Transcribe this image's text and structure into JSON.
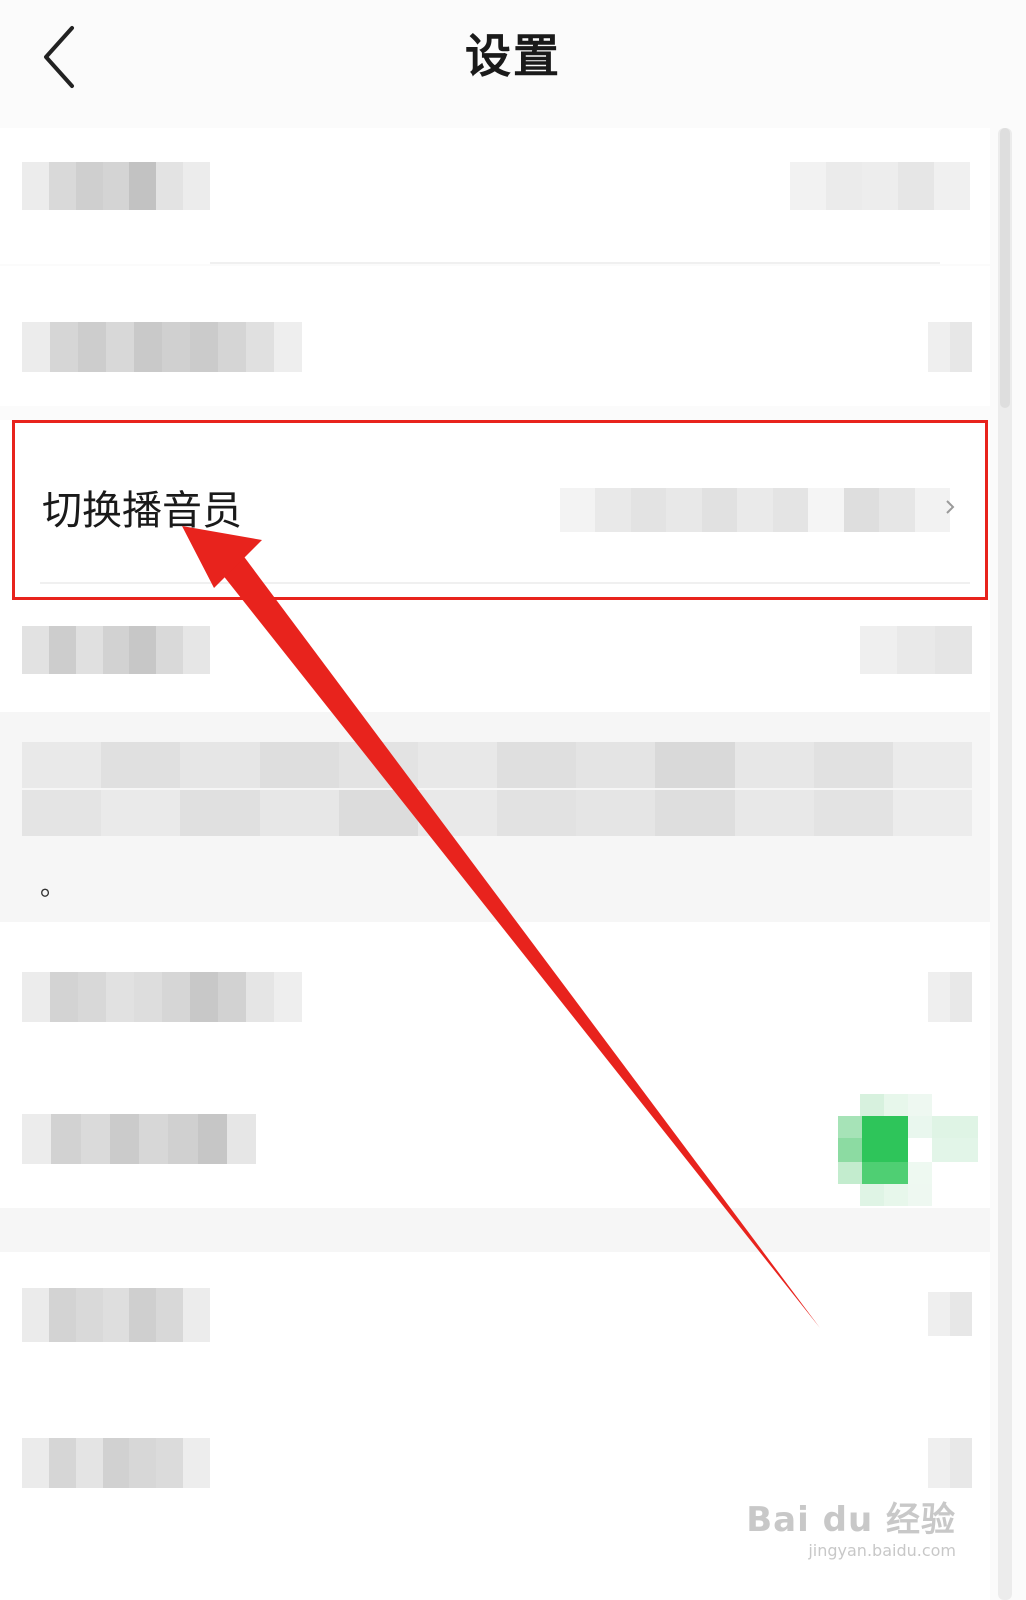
{
  "header": {
    "title": "设置"
  },
  "highlighted_row": {
    "label": "切换播音员"
  },
  "list_note": {
    "text": "。"
  },
  "watermark": {
    "brand": "Bai du 经验",
    "url": "jingyan.baidu.com"
  },
  "colors": {
    "annotation_red": "#e8231d",
    "toggle_green": "#2ec55a",
    "blur_gray": "#d6d6d6"
  },
  "icons": {
    "back": "chevron-left-icon",
    "row_arrow": "chevron-right-icon",
    "paw": "baidu-paw-icon"
  }
}
